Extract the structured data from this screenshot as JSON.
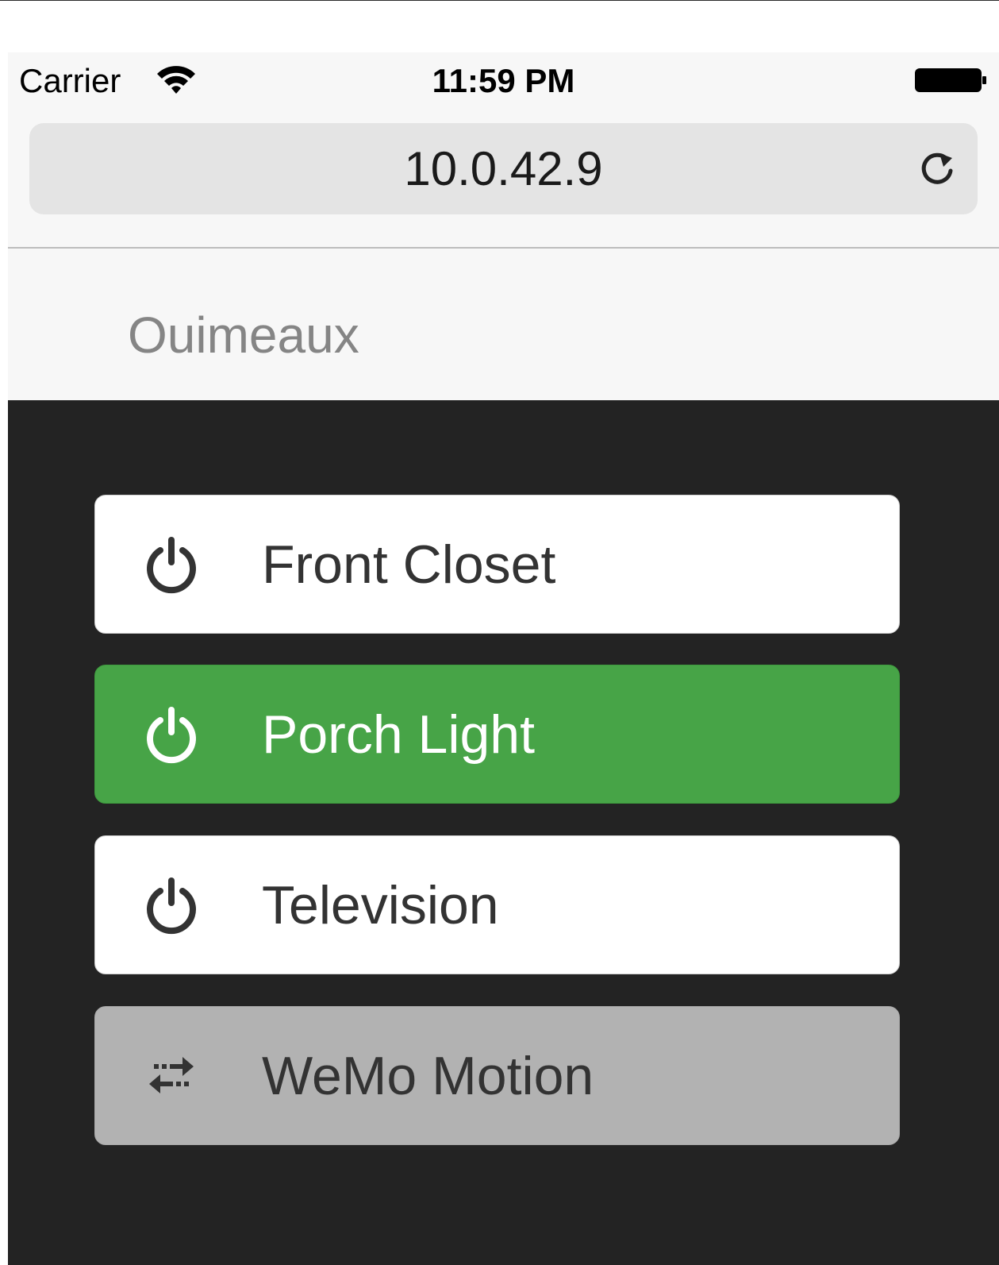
{
  "status_bar": {
    "carrier": "Carrier",
    "time": "11:59 PM",
    "wifi_icon": "wifi-icon",
    "battery_icon": "battery-full-icon"
  },
  "browser": {
    "url": "10.0.42.9",
    "reload_icon": "reload-icon"
  },
  "navbar": {
    "brand": "Ouimeaux"
  },
  "devices": [
    {
      "label": "Front Closet",
      "icon": "power-icon",
      "state": "off"
    },
    {
      "label": "Porch Light",
      "icon": "power-icon",
      "state": "on"
    },
    {
      "label": "Television",
      "icon": "power-icon",
      "state": "off"
    },
    {
      "label": "WeMo Motion",
      "icon": "transfer-arrows-icon",
      "state": "sensor"
    }
  ],
  "colors": {
    "on": "#47a447",
    "off": "#ffffff",
    "sensor": "#b2b2b2",
    "background": "#232323"
  }
}
